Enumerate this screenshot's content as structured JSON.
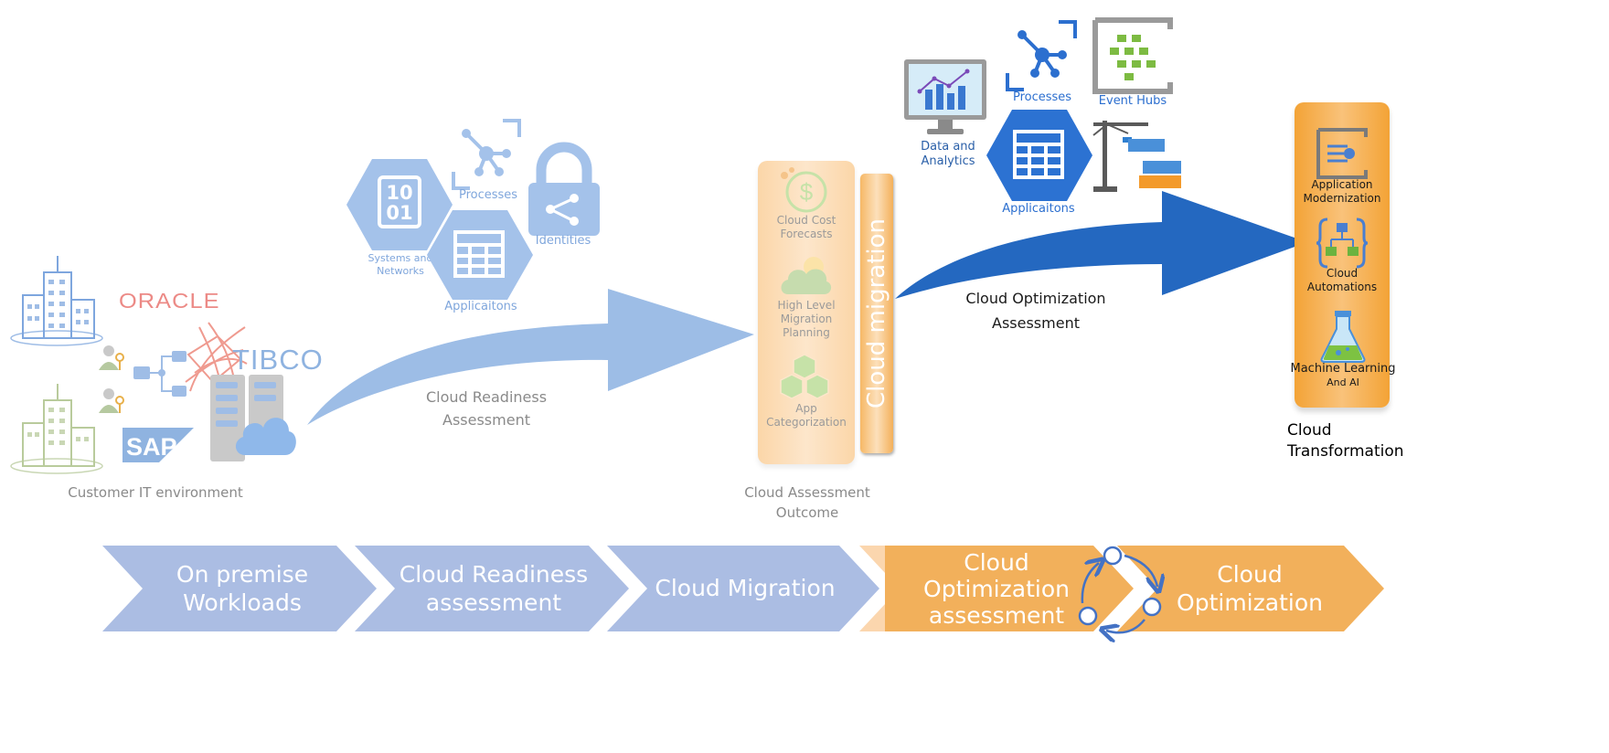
{
  "customer_env": {
    "label": "Customer IT environment",
    "logos": [
      "ORACLE",
      "TIBCO",
      "SAP"
    ]
  },
  "readiness_icons": {
    "systems_networks": {
      "glyph": "10\n01",
      "line1": "Systems and",
      "line2": "Networks"
    },
    "processes": "Processes",
    "identities": "Identities",
    "applications": "Applicaitons"
  },
  "arrow1": {
    "line1": "Cloud Readiness",
    "line2": "Assessment"
  },
  "assessment_outcome": {
    "items": [
      {
        "icon": "dollar-icon",
        "line1": "Cloud Cost",
        "line2": "Forecasts"
      },
      {
        "icon": "cloud-icon",
        "line1": "High Level",
        "line2": "Migration",
        "line3": "Planning"
      },
      {
        "icon": "cubes-icon",
        "line1": "App",
        "line2": "Categorization"
      }
    ],
    "side_bar_label": "Cloud migration",
    "caption_line1": "Cloud Assessment",
    "caption_line2": "Outcome"
  },
  "optimization_icons": {
    "data_analytics_line1": "Data and",
    "data_analytics_line2": "Analytics",
    "processes": "Processes",
    "event_hubs": "Event Hubs",
    "applications": "Applicaitons"
  },
  "arrow2": {
    "line1": "Cloud Optimization",
    "line2": "Assessment"
  },
  "transformation": {
    "items": [
      {
        "line1": "Application",
        "line2": "Modernization"
      },
      {
        "line1": "Cloud",
        "line2": "Automations"
      },
      {
        "line1": "Machine Learning",
        "line2": "And AI"
      }
    ],
    "caption_line1": "Cloud",
    "caption_line2": "Transformation"
  },
  "process_chevrons": [
    {
      "line1": "On premise",
      "line2": "Workloads"
    },
    {
      "line1": "Cloud Readiness",
      "line2": "assessment"
    },
    {
      "line1": "Cloud Migration",
      "line2": ""
    },
    {
      "line1": "Cloud",
      "line2": "Optimization",
      "line3": "assessment"
    },
    {
      "line1": "Cloud",
      "line2": "Optimization"
    }
  ],
  "colors": {
    "chevron_blue": "#abbde3",
    "chevron_orange": "#f2b05b",
    "arrow_light": "#9dbde6",
    "arrow_dark": "#2468c0",
    "outcome_panel": "#fbd9b0",
    "transform_panel": "#f5a940",
    "cycle_blue": "#4472c4"
  }
}
